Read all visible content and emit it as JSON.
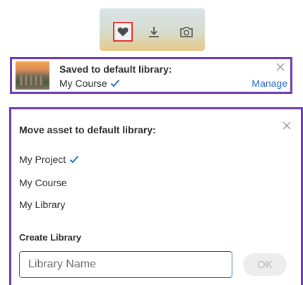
{
  "toolbar": {
    "icons": [
      "heart-icon",
      "download-icon",
      "camera-icon"
    ],
    "selected_color": "#e03a3a"
  },
  "toast": {
    "title": "Saved to default library:",
    "library": "My Course",
    "action_label": "Manage",
    "border_color": "#6e3cb4",
    "link_color": "#2b6fd1"
  },
  "panel": {
    "title": "Move asset to default library:",
    "libraries": [
      {
        "label": "My Project",
        "checked": true
      },
      {
        "label": "My Course",
        "checked": false
      },
      {
        "label": "My Library",
        "checked": false
      }
    ],
    "create_label": "Create Library",
    "input_placeholder": "Library Name",
    "ok_label": "OK"
  }
}
